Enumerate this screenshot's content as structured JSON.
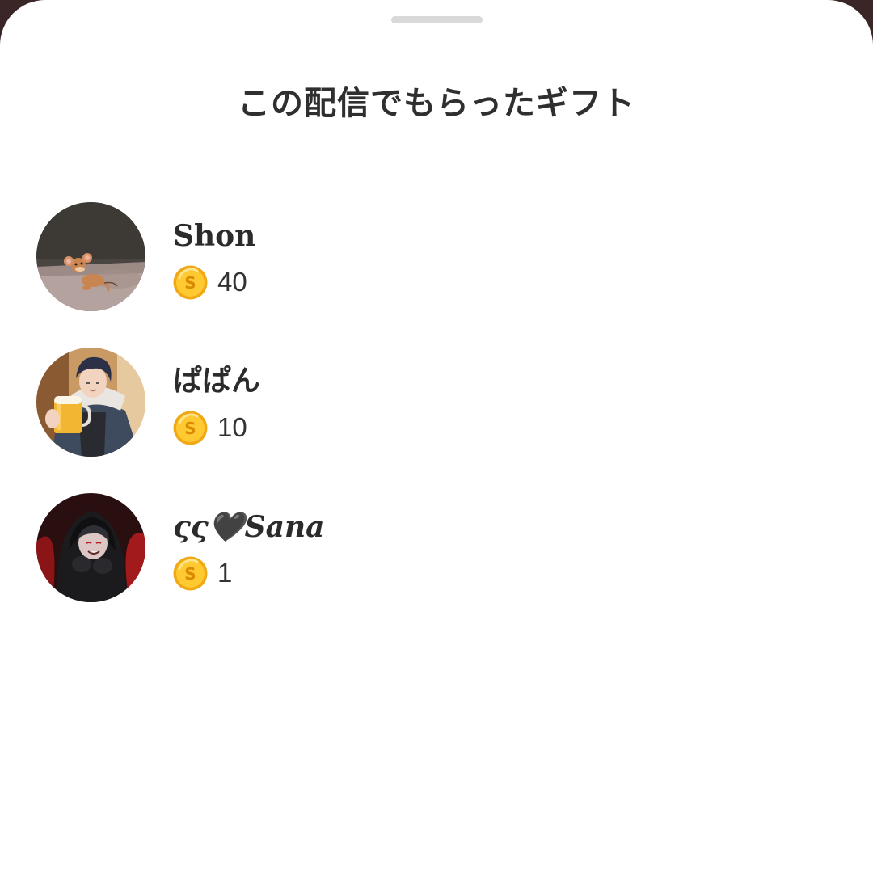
{
  "sheet": {
    "title": "この配信でもらったギフト"
  },
  "gifts": [
    {
      "name": "Shon",
      "amount": "40",
      "avatar_icon": "mouse-cartoon-avatar-icon"
    },
    {
      "name": "ぱぱん",
      "amount": "10",
      "avatar_icon": "anime-man-beer-avatar-icon"
    },
    {
      "name": "ςς🖤𝑺𝒂𝒏𝒂",
      "amount": "1",
      "avatar_icon": "anime-hooded-avatar-icon"
    }
  ],
  "coin": {
    "icon": "coin-icon",
    "symbol": "S",
    "color": "#f5b51c"
  }
}
